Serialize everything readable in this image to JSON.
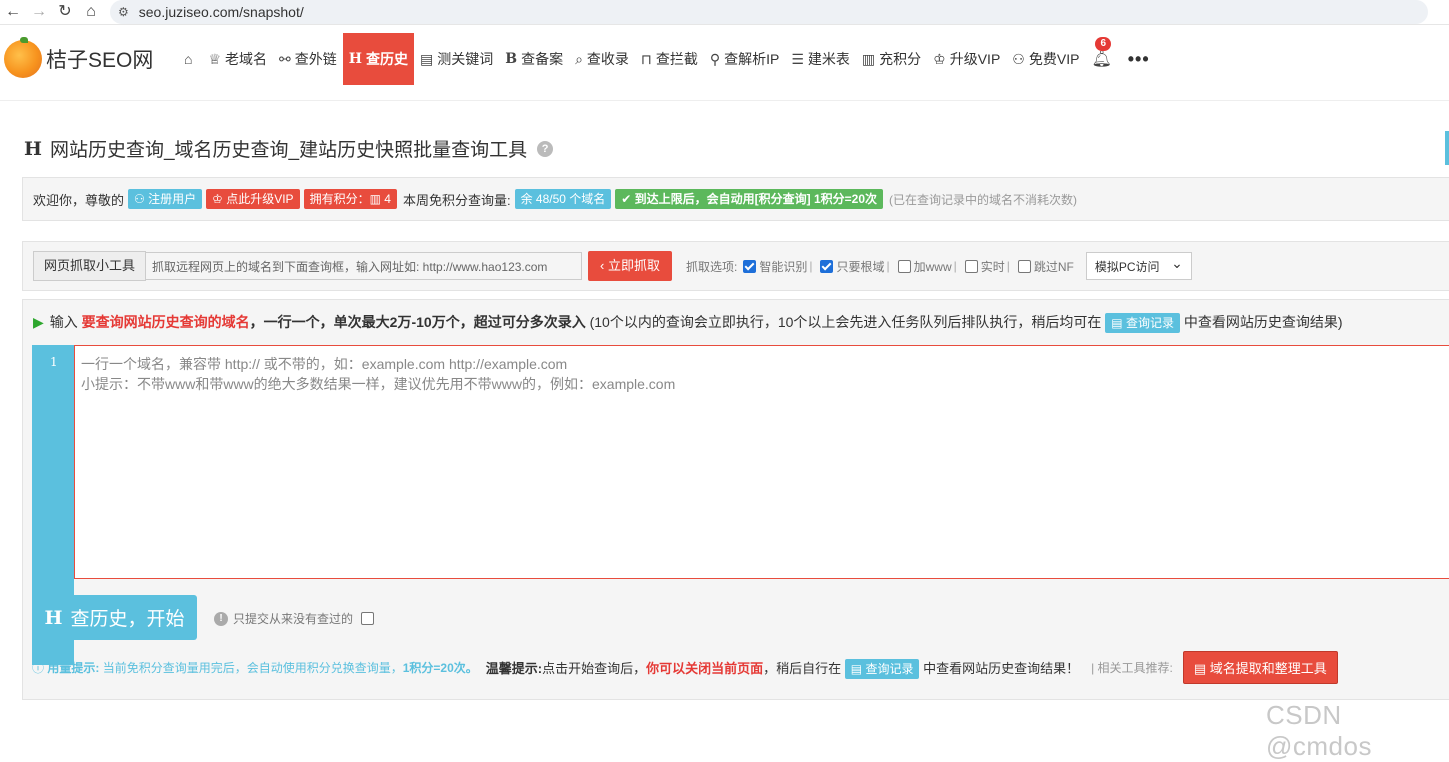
{
  "browser": {
    "url": "seo.juziseo.com/snapshot/"
  },
  "nav": {
    "logo_text": "桔子SEO网",
    "items": [
      {
        "label": "老域名",
        "icon": "home-icon"
      },
      {
        "label": "查外链",
        "icon": "link-icon"
      },
      {
        "label": "查历史",
        "icon": "h-icon",
        "active": true
      },
      {
        "label": "测关键词",
        "icon": "doc-icon"
      },
      {
        "label": "查备案",
        "icon": "b-icon"
      },
      {
        "label": "查收录",
        "icon": "search-icon"
      },
      {
        "label": "查拦截",
        "icon": "lock-icon"
      },
      {
        "label": "查解析IP",
        "icon": "pin-icon"
      },
      {
        "label": "建米表",
        "icon": "list-icon"
      },
      {
        "label": "充积分",
        "icon": "chart-icon"
      },
      {
        "label": "升级VIP",
        "icon": "crown-icon"
      },
      {
        "label": "免费VIP",
        "icon": "user-add-icon"
      }
    ],
    "bell_count": "6",
    "more": "•••"
  },
  "page": {
    "title": "网站历史查询_域名历史查询_建站历史快照批量查询工具",
    "title_prefix": "H",
    "help": "?"
  },
  "welcome": {
    "greeting": "欢迎你，尊敬的",
    "user_role": "注册用户",
    "upgrade": "点此升级VIP",
    "points": "拥有积分：",
    "points_value": "4",
    "quota_label": "本周免积分查询量:",
    "quota_value": "余 48/50 个域名",
    "auto_use": "到达上限后，会自动用[积分查询] 1积分=20次",
    "note": "(已在查询记录中的域名不消耗次数)"
  },
  "tool": {
    "addon_label": "网页抓取小工具",
    "input_placeholder": "抓取远程网页上的域名到下面查询框，输入网址如: http://www.hao123.com",
    "fetch_button": "立即抓取",
    "options_label": "抓取选项:",
    "options": [
      {
        "label": "智能识别",
        "checked": true
      },
      {
        "label": "只要根域",
        "checked": true
      },
      {
        "label": "加www",
        "checked": false
      },
      {
        "label": "实时",
        "checked": false
      },
      {
        "label": "跳过NF",
        "checked": false
      }
    ],
    "select_value": "模拟PC访问"
  },
  "main": {
    "hint_prefix": "输入",
    "hint_red": "要查询网站历史查询的域名",
    "hint_bold": "，一行一个，单次最大2万-10万个，超过可分多次录入",
    "hint_rest": "(10个以内的查询会立即执行，10个以上会先进入任务队列后排队执行，稍后均可在",
    "records_button": "查询记录",
    "hint_tail": "中查看网站历史查询结果)",
    "line_number": "1",
    "editor_line1": "一行一个域名，兼容带 http:// 或不带的，如：example.com http://example.com",
    "editor_line2": "小提示：不带www和带www的绝大多数结果一样，建议优先用不带www的，例如：example.com",
    "start_button": "查历史，开始",
    "start_prefix": "H",
    "only_new": "只提交从来没有查过的",
    "usage_label": "用量提示:",
    "usage_text": "当前免积分查询量用完后，会自动使用积分兑换查询量，",
    "usage_bold": "1积分=20次。",
    "tip_label": "温馨提示:",
    "tip_text": "点击开始查询后，",
    "tip_red": "你可以关闭当前页面",
    "tip_text2": "，稍后自行在",
    "tip_records": "查询记录",
    "tip_tail": "中查看网站历史查询结果！",
    "related_label": "| 相关工具推荐:",
    "extract_button": "域名提取和整理工具"
  },
  "watermark": "CSDN @cmdos"
}
